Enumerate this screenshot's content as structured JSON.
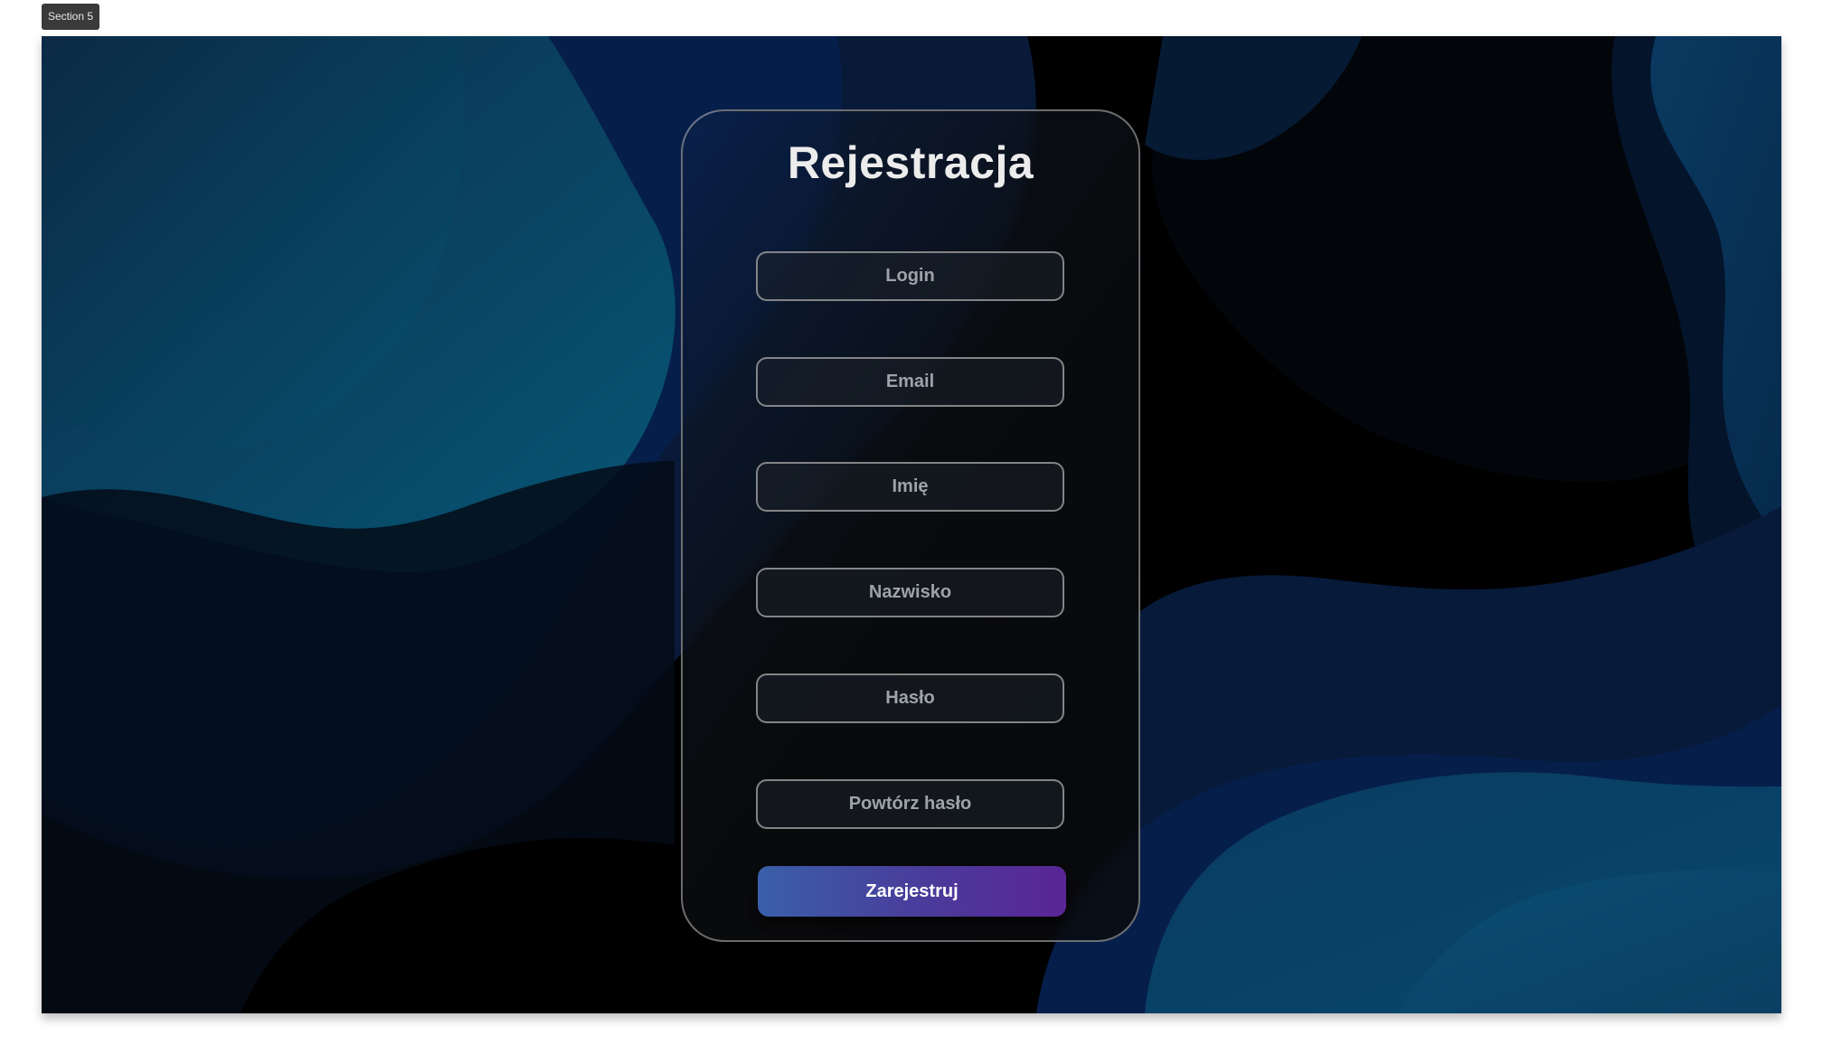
{
  "section_label": "Section 5",
  "form": {
    "title": "Rejestracja",
    "fields": [
      {
        "placeholder": "Login",
        "value": ""
      },
      {
        "placeholder": "Email",
        "value": ""
      },
      {
        "placeholder": "Imię",
        "value": ""
      },
      {
        "placeholder": "Nazwisko",
        "value": ""
      },
      {
        "placeholder": "Hasło",
        "value": ""
      },
      {
        "placeholder": "Powtórz hasło",
        "value": ""
      }
    ],
    "submit_label": "Zarejestruj"
  },
  "colors": {
    "accent_gradient_start": "#3a5fa8",
    "accent_gradient_end": "#5a2596",
    "background_blue": "#0b4a6e",
    "background_navy": "#061c46"
  }
}
